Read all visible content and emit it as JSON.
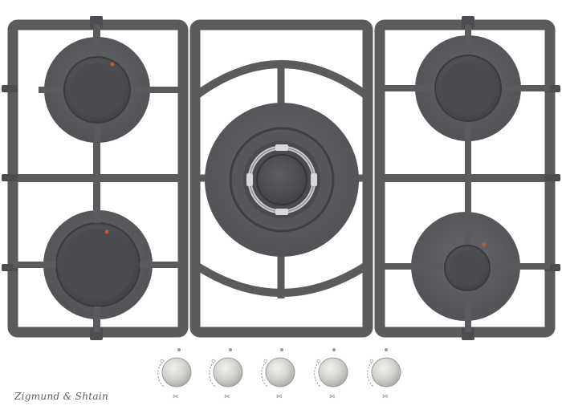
{
  "product": {
    "brand_logo_text": "Zigmund & Shtain"
  },
  "hob": {
    "burners": [
      {
        "name": "rear-left-burner",
        "type": "standard"
      },
      {
        "name": "front-left-burner",
        "type": "standard"
      },
      {
        "name": "center-wok-burner",
        "type": "triple-crown wok"
      },
      {
        "name": "rear-right-burner",
        "type": "standard"
      },
      {
        "name": "front-right-burner",
        "type": "simmer"
      }
    ],
    "control_knobs": 5,
    "colors": {
      "glass": "#ffffff",
      "grate": "#5a5b5d",
      "burner_cap": "#4e4f52",
      "knob": "#d2d0cc"
    }
  }
}
